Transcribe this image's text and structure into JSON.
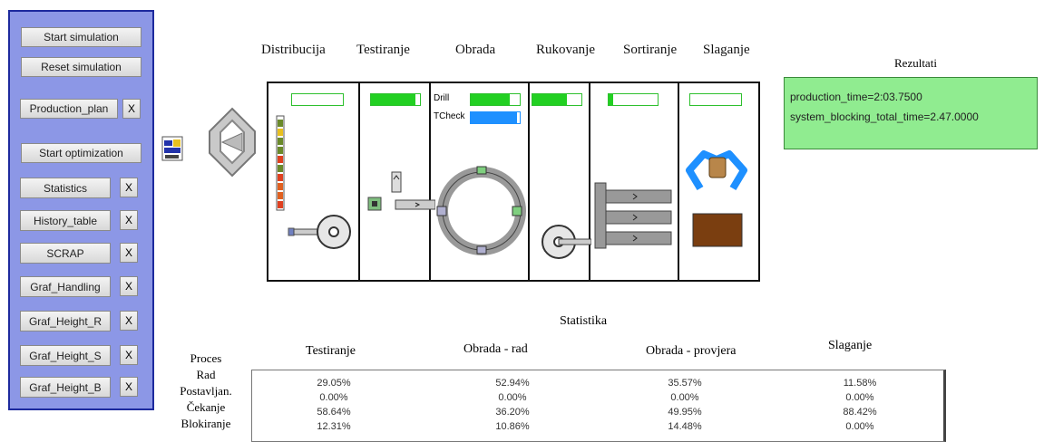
{
  "panel": {
    "start_simulation": "Start simulation",
    "reset_simulation": "Reset simulation",
    "production_plan": "Production_plan",
    "start_optimization": "Start optimization",
    "close_label": "X",
    "tables": [
      {
        "label": "Statistics"
      },
      {
        "label": "History_table"
      },
      {
        "label": "SCRAP"
      },
      {
        "label": "Graf_Handling"
      },
      {
        "label": "Graf_Height_R"
      },
      {
        "label": "Graf_Height_S"
      },
      {
        "label": "Graf_Height_B"
      }
    ]
  },
  "stages": [
    "Distribucija",
    "Testiranje",
    "Obrada",
    "Rukovanje",
    "Sortiranje",
    "Slaganje"
  ],
  "plant": {
    "drill_label": "Drill",
    "tcheck_label": "TCheck",
    "levels": {
      "distribucija": 0.0,
      "testiranje": 0.9,
      "drill": 0.8,
      "tcheck": 0.95,
      "rukovanje": 0.7,
      "sortiranje": 0.1,
      "slaganje": 0.0
    }
  },
  "results": {
    "title": "Rezultati",
    "line1": "production_time=2:03.7500",
    "line2": "system_blocking_total_time=2.47.0000"
  },
  "stats": {
    "title": "Statistika",
    "columns": [
      "Testiranje",
      "Obrada - rad",
      "Obrada - provjera",
      "Slaganje"
    ],
    "row_labels": [
      "Proces",
      "Rad",
      "Postavljan.",
      "Čekanje",
      "Blokiranje"
    ],
    "rows": [
      [
        "29.05%",
        "52.94%",
        "35.57%",
        "11.58%"
      ],
      [
        "0.00%",
        "0.00%",
        "0.00%",
        "0.00%"
      ],
      [
        "58.64%",
        "36.20%",
        "49.95%",
        "88.42%"
      ],
      [
        "12.31%",
        "10.86%",
        "14.48%",
        "0.00%"
      ]
    ]
  },
  "colors": {
    "panel": "#8c97e6",
    "results_bg": "#90ec90",
    "level_fill": "#22d022",
    "tcheck_fill": "#1e90ff"
  }
}
